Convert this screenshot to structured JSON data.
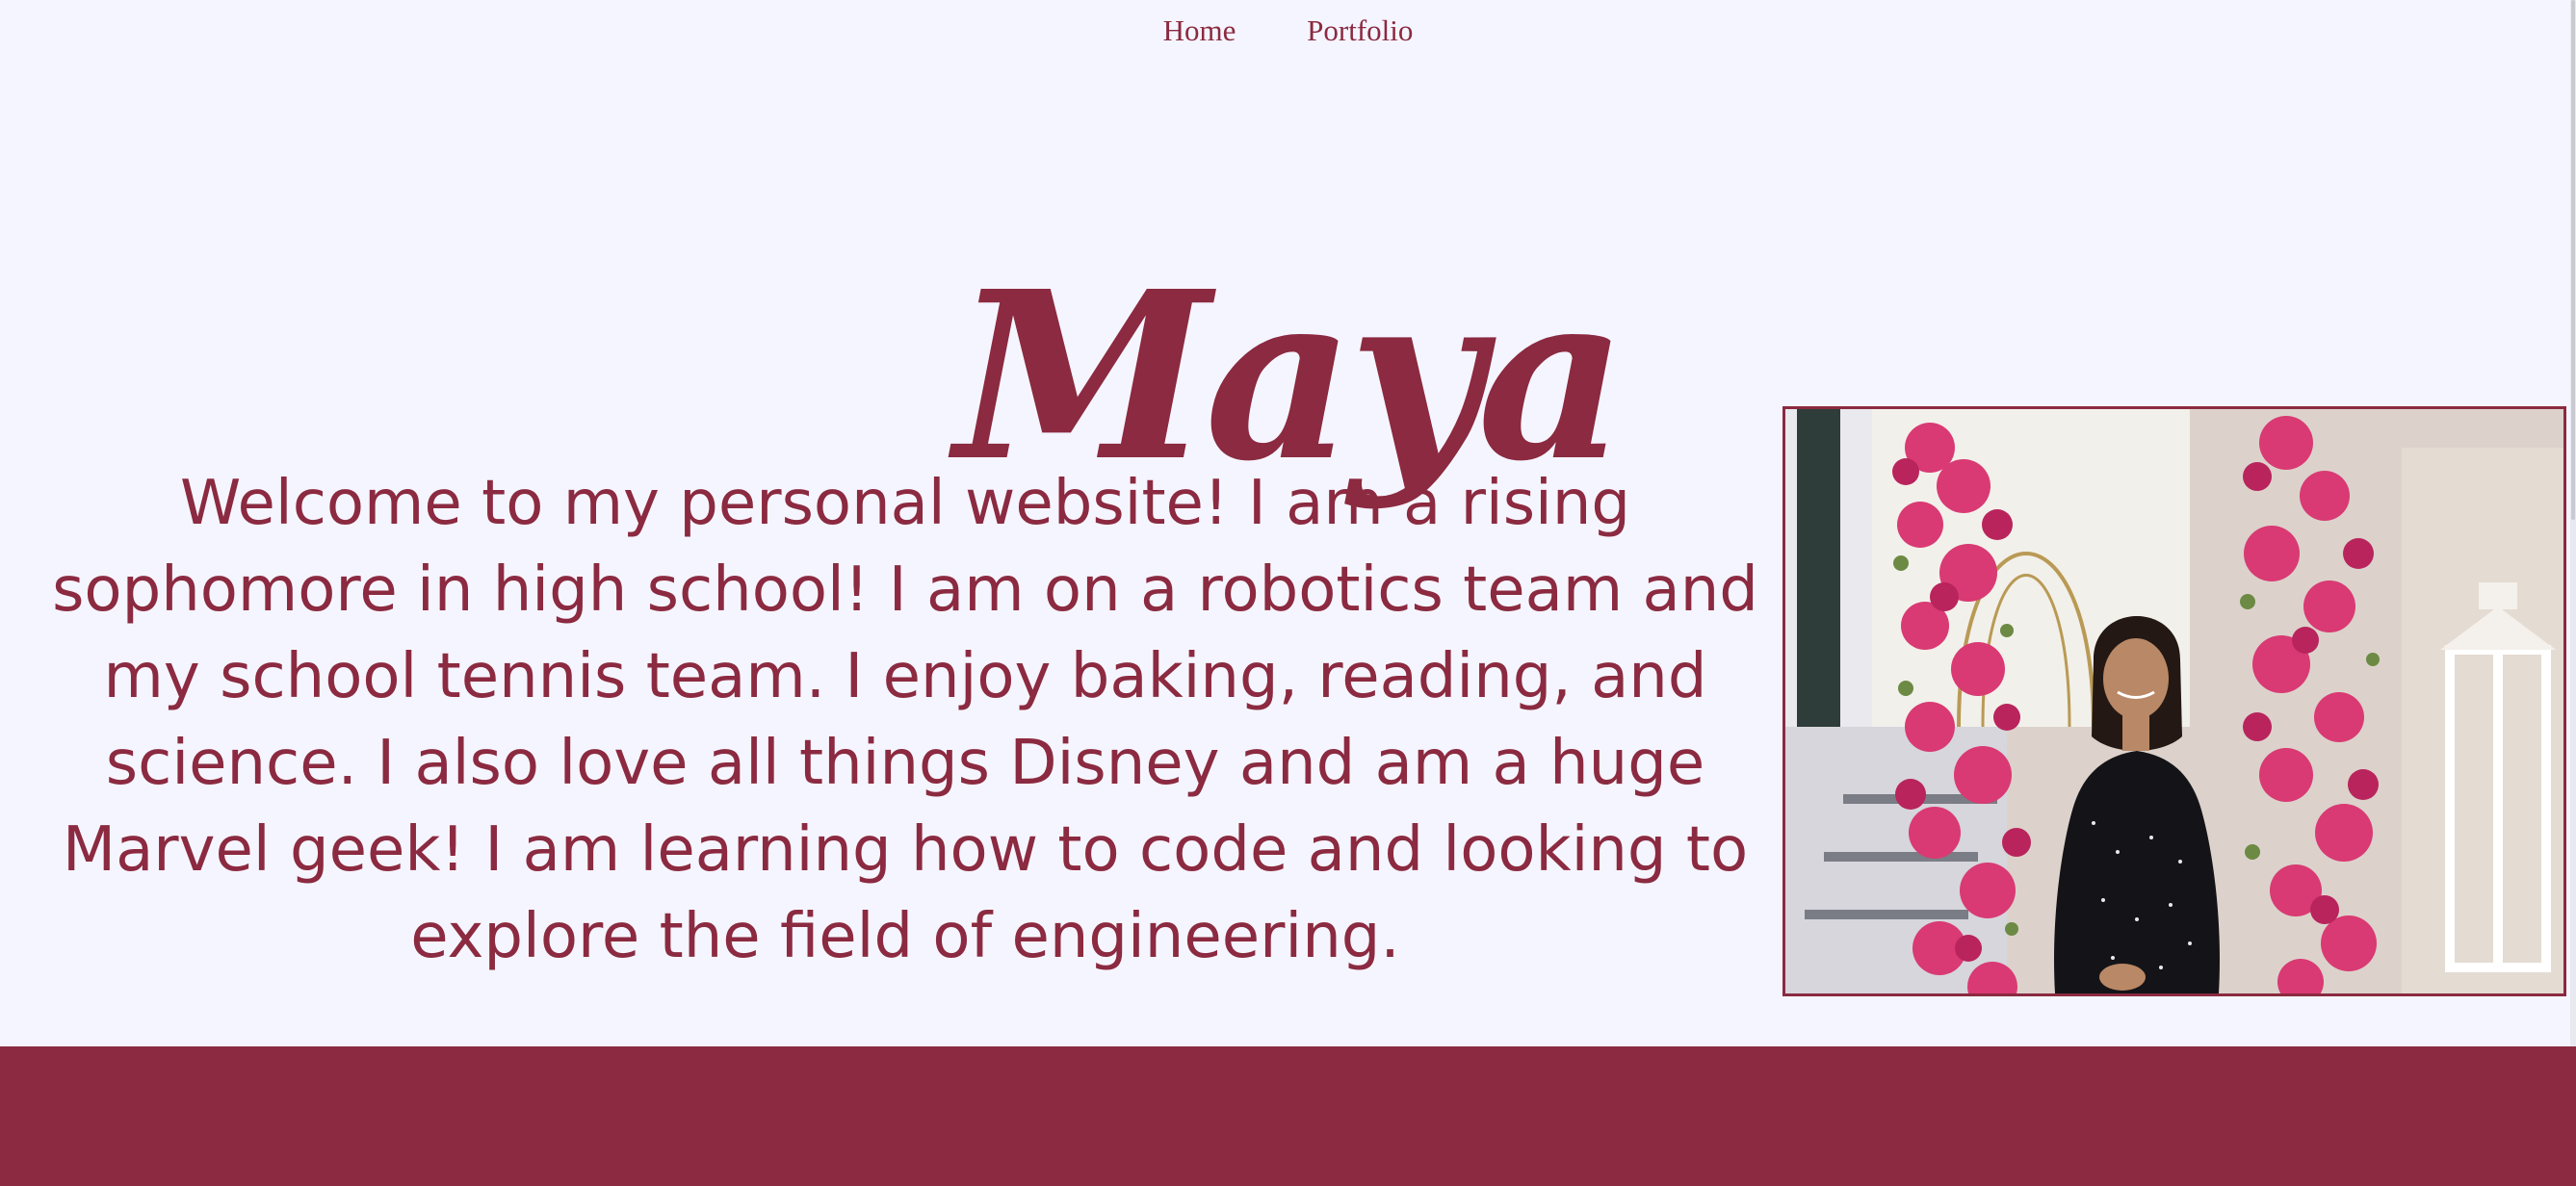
{
  "nav": {
    "items": [
      {
        "label": "Home"
      },
      {
        "label": "Portfolio"
      }
    ]
  },
  "hero": {
    "title": "Maya"
  },
  "intro": {
    "text": "Welcome to my personal website! I am a rising sophomore in high school! I am on a robotics team and my school tennis team. I enjoy baking, reading, and science. I also love all things Disney and am a huge Marvel geek! I am learning how to code and looking to explore the field of engineering."
  },
  "colors": {
    "accent": "#8b2a40",
    "background": "#f5f5ff"
  },
  "photo": {
    "icon": "profile-photo"
  }
}
